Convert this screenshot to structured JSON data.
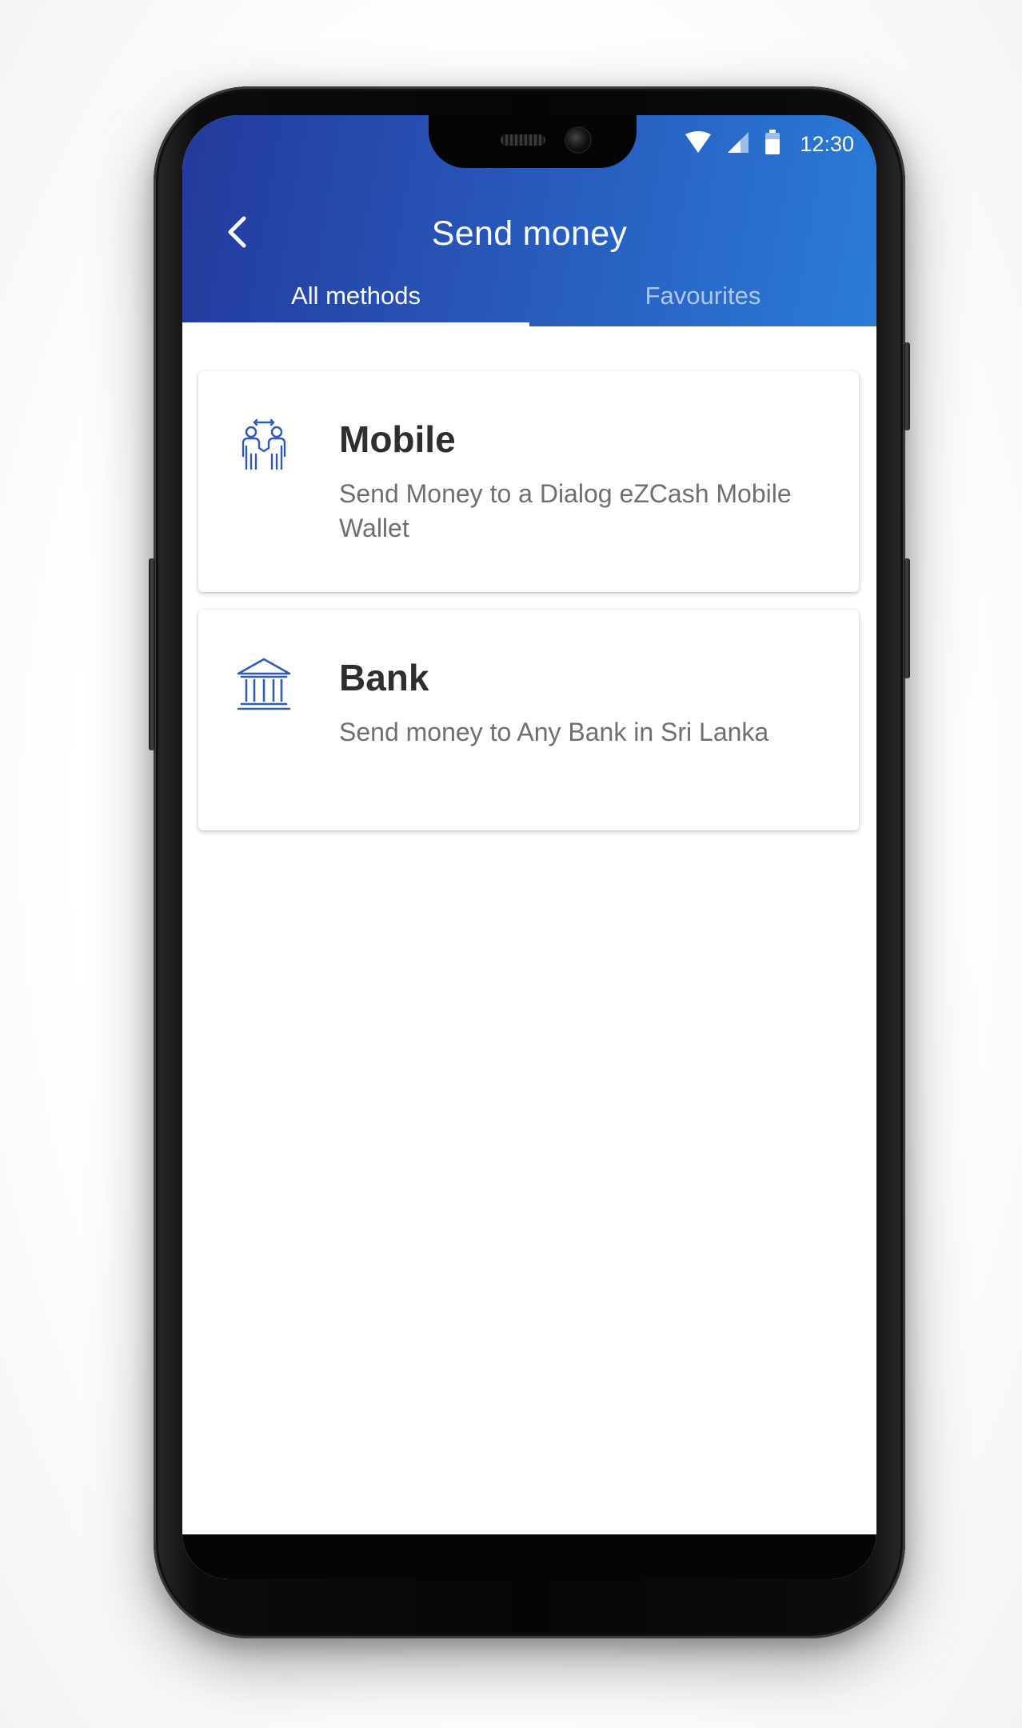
{
  "status_bar": {
    "time": "12:30",
    "icons": [
      "wifi-icon",
      "cell-signal-icon",
      "battery-icon"
    ]
  },
  "header": {
    "title": "Send money",
    "back_icon": "chevron-left-icon"
  },
  "tabs": [
    {
      "label": "All methods",
      "active": true
    },
    {
      "label": "Favourites",
      "active": false
    }
  ],
  "methods": [
    {
      "title": "Mobile",
      "description": "Send Money to a Dialog eZCash Mobile Wallet",
      "icon": "people-transfer-icon"
    },
    {
      "title": "Bank",
      "description": "Send money to Any Bank in Sri Lanka",
      "icon": "bank-icon"
    }
  ],
  "colors": {
    "header_gradient_start": "#233a9c",
    "header_gradient_end": "#2a7bd9",
    "icon_blue": "#2f5bbf",
    "title_text": "#2e2e2e",
    "desc_text": "#6f6f6f"
  }
}
